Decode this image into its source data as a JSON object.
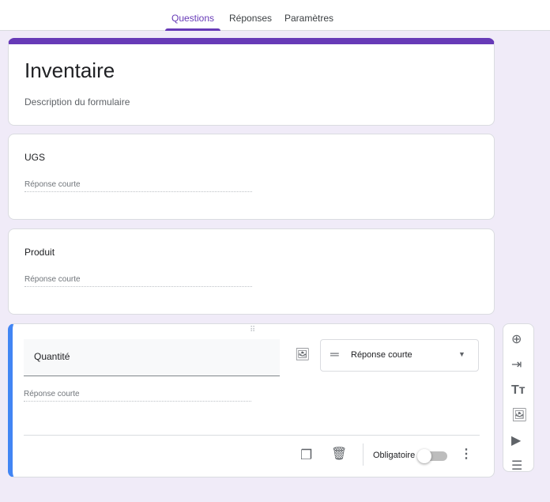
{
  "tabs": [
    "Questions",
    "Réponses",
    "Paramètres"
  ],
  "form": {
    "title": "Inventaire",
    "description": "Description du formulaire"
  },
  "questions": [
    {
      "label": "UGS",
      "answer": "Réponse courte"
    },
    {
      "label": "Produit",
      "answer": "Réponse courte"
    },
    {
      "label": "Quantité",
      "answer": "Réponse courte",
      "type": "Réponse courte",
      "required_label": "Obligatoire",
      "required": false
    }
  ],
  "colors": {
    "accent": "#673ab7",
    "active": "#4285f4",
    "bg": "#f0ebf8"
  }
}
